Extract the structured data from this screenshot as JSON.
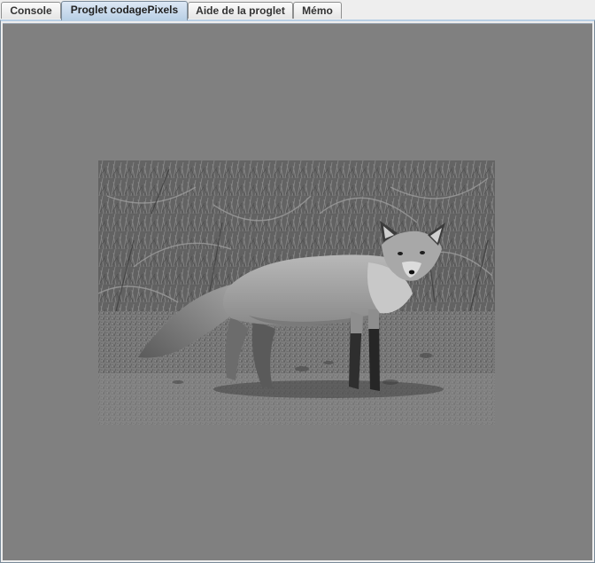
{
  "tabs": [
    {
      "label": "Console",
      "selected": false
    },
    {
      "label": "Proglet codagePixels",
      "selected": true
    },
    {
      "label": "Aide de la proglet",
      "selected": false
    },
    {
      "label": "Mémo",
      "selected": false
    }
  ],
  "canvas": {
    "background_color": "#808080",
    "image_subject": "grayscale photo of a red fox standing in grass"
  }
}
